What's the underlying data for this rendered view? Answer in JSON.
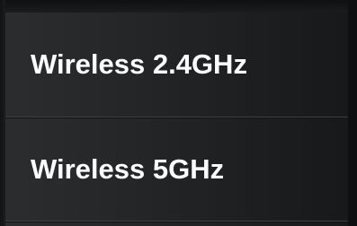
{
  "menu": {
    "items": [
      {
        "label": "Wireless 2.4GHz"
      },
      {
        "label": "Wireless 5GHz"
      }
    ]
  },
  "colors": {
    "background": "#232527",
    "separator": "#3f4144",
    "text": "#ffffff"
  }
}
